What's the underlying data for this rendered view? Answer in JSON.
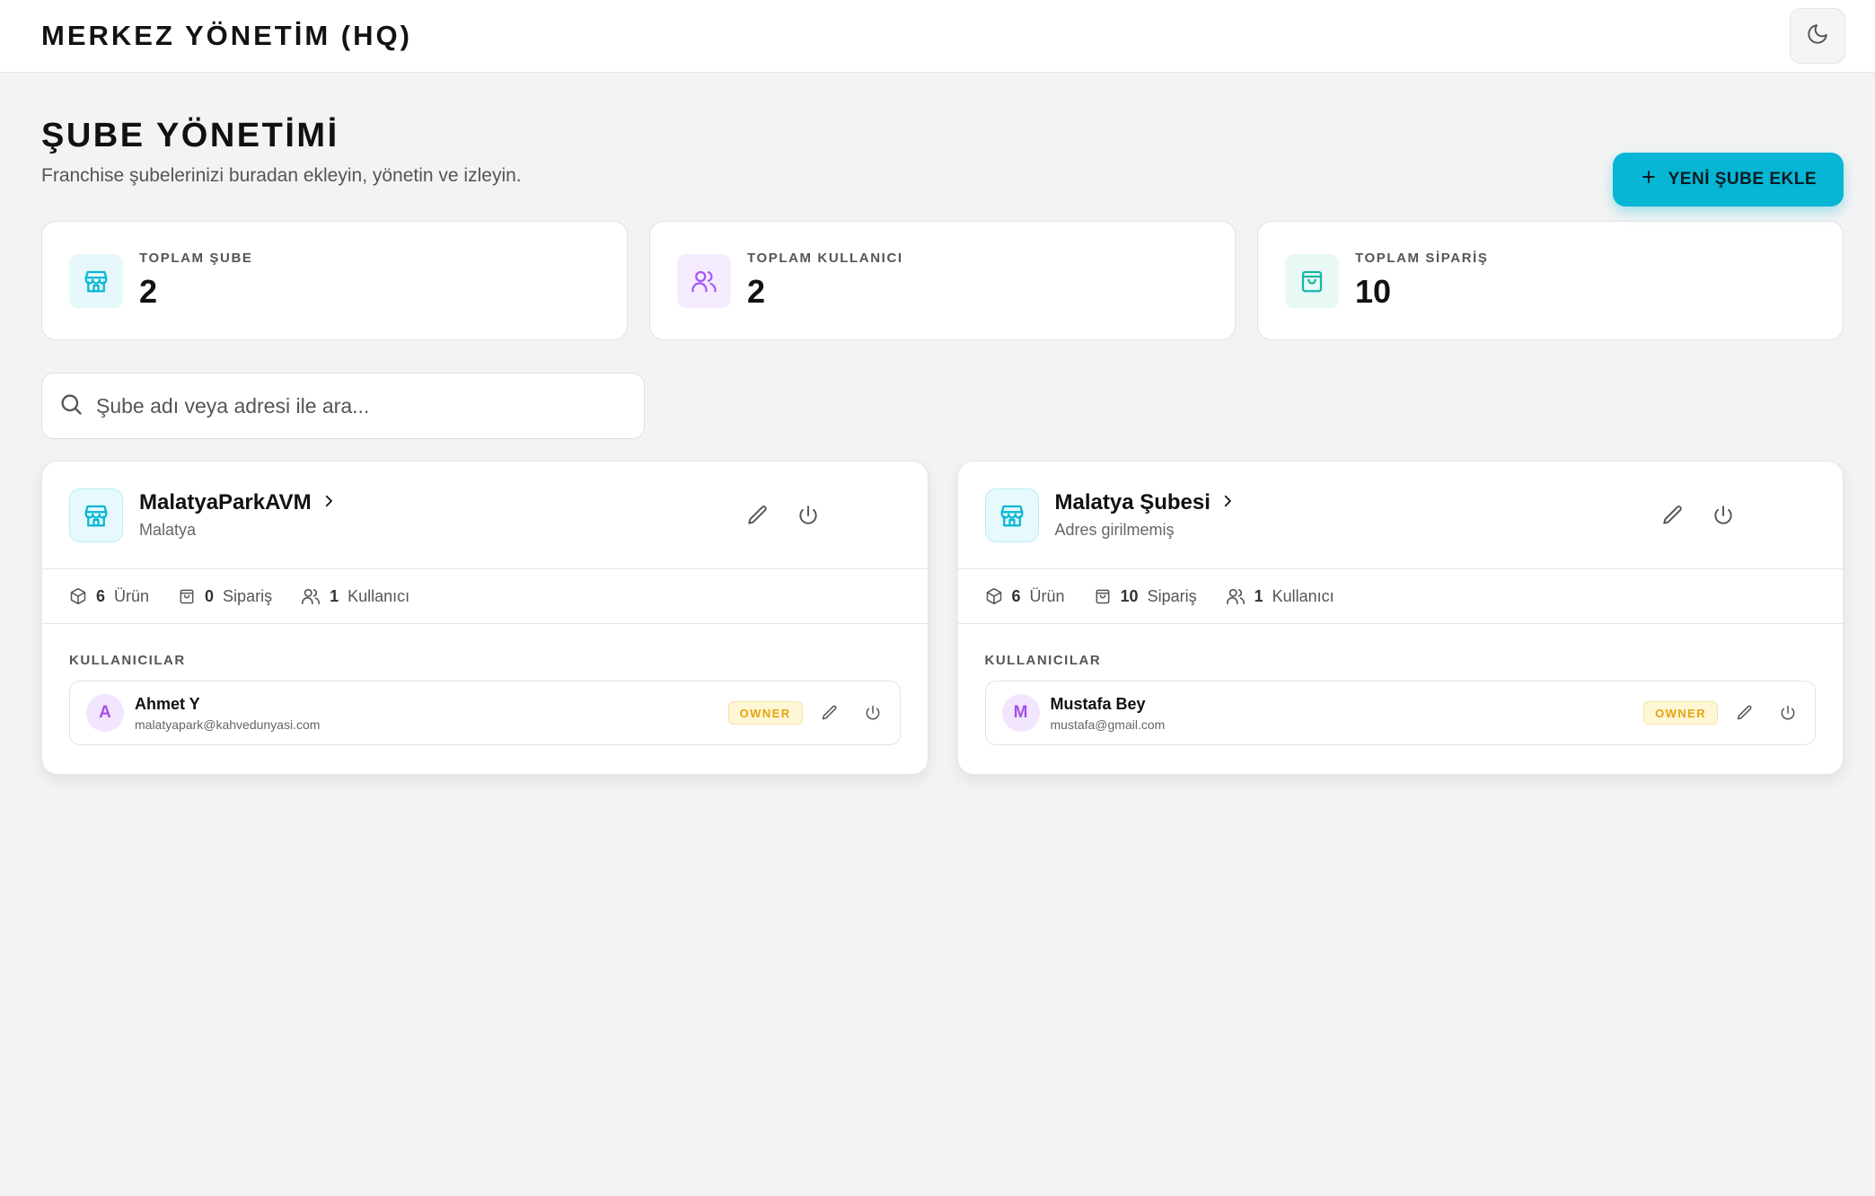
{
  "app": {
    "title": "MERKEZ YÖNETİM (HQ)"
  },
  "header": {
    "title": "ŞUBE YÖNETİMİ",
    "subtitle": "Franchise şubelerinizi buradan ekleyin, yönetin ve izleyin.",
    "add_button_label": "YENİ ŞUBE EKLE"
  },
  "stats": [
    {
      "label": "TOPLAM ŞUBE",
      "value": "2",
      "icon": "store-icon",
      "color": "#06b6d4",
      "bg": "#e6f8fb"
    },
    {
      "label": "TOPLAM KULLANICI",
      "value": "2",
      "icon": "users-icon",
      "color": "#a855f7",
      "bg": "#f5edff"
    },
    {
      "label": "TOPLAM SİPARİŞ",
      "value": "10",
      "icon": "shopping-bag-icon",
      "color": "#14b8a6",
      "bg": "#e8f8f5"
    }
  ],
  "search": {
    "placeholder": "Şube adı veya adresi ile ara..."
  },
  "branches": [
    {
      "name": "MalatyaParkAVM",
      "address": "Malatya",
      "products": "6",
      "products_label": "Ürün",
      "orders": "0",
      "orders_label": "Sipariş",
      "users": "1",
      "users_label": "Kullanıcı",
      "users_section_label": "KULLANICILAR",
      "user": {
        "initial": "A",
        "name": "Ahmet Y",
        "email": "malatyapark@kahvedunyasi.com",
        "role": "OWNER"
      }
    },
    {
      "name": "Malatya Şubesi",
      "address": "Adres girilmemiş",
      "products": "6",
      "products_label": "Ürün",
      "orders": "10",
      "orders_label": "Sipariş",
      "users": "1",
      "users_label": "Kullanıcı",
      "users_section_label": "KULLANICILAR",
      "user": {
        "initial": "M",
        "name": "Mustafa Bey",
        "email": "mustafa@gmail.com",
        "role": "OWNER"
      }
    }
  ],
  "colors": {
    "accent": "#06b6d4",
    "owner_badge": "#e3a40e",
    "avatar": "#a451e6"
  }
}
